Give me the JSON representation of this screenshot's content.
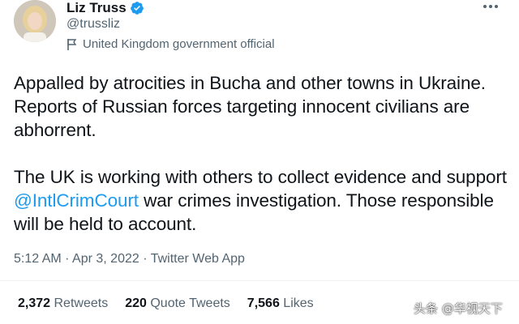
{
  "colors": {
    "accent": "#1d9bf0",
    "secondary_text": "#536471",
    "primary_text": "#0f1419"
  },
  "author": {
    "display_name": "Liz Truss",
    "handle": "@trussliz",
    "label": "United Kingdom government official",
    "verified_icon": "verified-badge-icon",
    "label_icon": "flag-icon",
    "more_icon": "more-horizontal-icon"
  },
  "tweet": {
    "paragraph1": "Appalled by atrocities in Bucha and other towns in Ukraine. Reports of Russian forces targeting innocent civilians are abhorrent.",
    "paragraph2_before": "The UK is working with others to collect evidence and support ",
    "paragraph2_mention": "@IntlCrimCourt",
    "paragraph2_after": " war crimes investigation. Those responsible will be held to account."
  },
  "meta": {
    "time": "5:12 AM",
    "sep1": " · ",
    "date": "Apr 3, 2022",
    "sep2": " · ",
    "source": "Twitter Web App"
  },
  "stats": [
    {
      "count": "2,372",
      "label": "Retweets"
    },
    {
      "count": "220",
      "label": "Quote Tweets"
    },
    {
      "count": "7,566",
      "label": "Likes"
    }
  ],
  "watermark": "头条 @华视天下"
}
